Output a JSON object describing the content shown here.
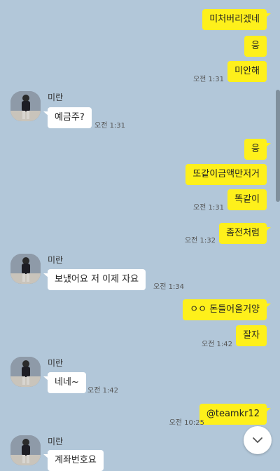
{
  "messages": [
    {
      "from": "me",
      "text": "미처버리겠네"
    },
    {
      "from": "me",
      "text": "응"
    },
    {
      "from": "me",
      "text": "미안해",
      "time": "오전 1:31"
    },
    {
      "from": "them",
      "sender": "미란",
      "text": "예금주?",
      "time": "오전 1:31"
    },
    {
      "from": "me",
      "text": "응"
    },
    {
      "from": "me",
      "text": "또같이금액만저거"
    },
    {
      "from": "me",
      "text": "똑같이",
      "time": "오전 1:31"
    },
    {
      "from": "me",
      "text": "좀전처럼",
      "time": "오전 1:32"
    },
    {
      "from": "them",
      "sender": "미란",
      "text": "보냈어요 저 이제 자요",
      "time": "오전 1:34"
    },
    {
      "from": "me",
      "text": "ㅇㅇ 돈들어올거양"
    },
    {
      "from": "me",
      "text": "잘자",
      "time": "오전 1:42"
    },
    {
      "from": "them",
      "sender": "미란",
      "text": "네네~",
      "time": "오전 1:42"
    },
    {
      "from": "me",
      "text": "@teamkr12",
      "time": "오전 10:25"
    },
    {
      "from": "them",
      "sender": "미란",
      "text": "계좌번호요"
    }
  ],
  "icons": {
    "scroll_down": "chevron-down-icon"
  },
  "colors": {
    "background": "#b2c7d9",
    "my_bubble": "#fef01b",
    "their_bubble": "#ffffff"
  }
}
